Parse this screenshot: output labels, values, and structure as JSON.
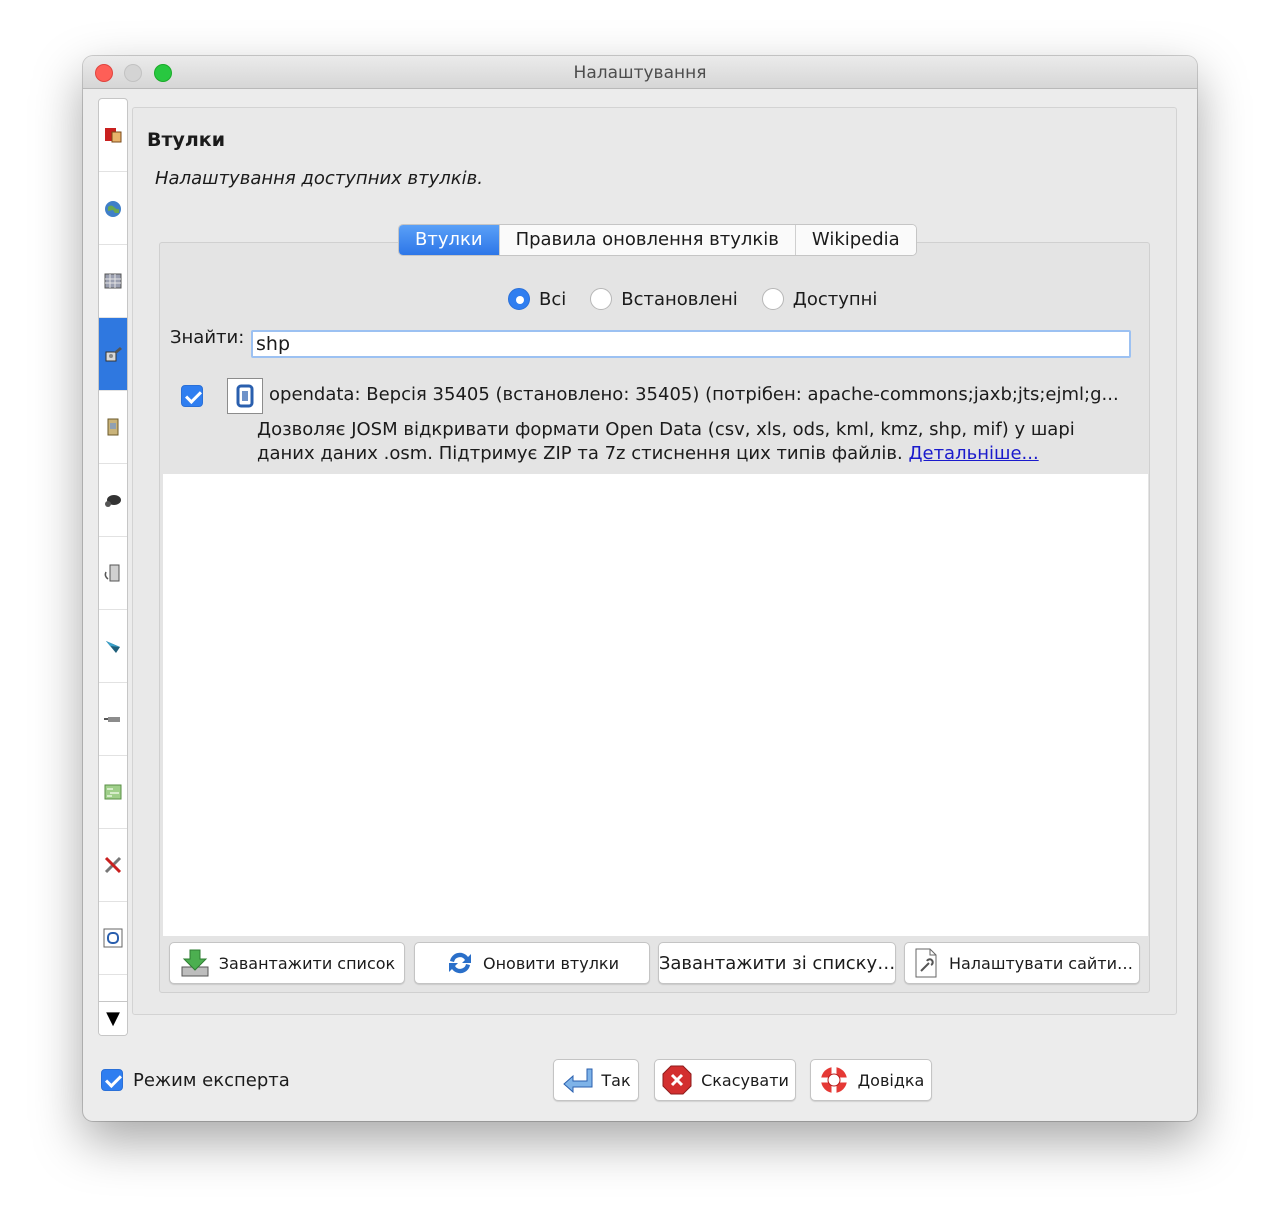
{
  "window": {
    "title": "Налаштування"
  },
  "sidebar": {
    "items": [
      {
        "icon": "display-settings-icon"
      },
      {
        "icon": "globe-icon"
      },
      {
        "icon": "map-grid-icon"
      },
      {
        "icon": "plugin-icon",
        "selected": true
      },
      {
        "icon": "presets-icon"
      },
      {
        "icon": "shortcuts-icon"
      },
      {
        "icon": "connection-icon"
      },
      {
        "icon": "remote-control-icon"
      },
      {
        "icon": "projection-icon"
      },
      {
        "icon": "map-paint-icon"
      },
      {
        "icon": "advanced-tools-icon"
      },
      {
        "icon": "opendata-icon"
      }
    ],
    "scroll_down": "▼"
  },
  "page": {
    "title": "Втулки",
    "description": "Налаштування доступних втулків."
  },
  "tabs": [
    {
      "label": "Втулки",
      "active": true
    },
    {
      "label": "Правила оновлення втулків",
      "active": false
    },
    {
      "label": "Wikipedia",
      "active": false
    }
  ],
  "filter": {
    "options": [
      {
        "label": "Всі",
        "selected": true
      },
      {
        "label": "Встановлені",
        "selected": false
      },
      {
        "label": "Доступні",
        "selected": false
      }
    ]
  },
  "search": {
    "label": "Знайти:",
    "value": "shp"
  },
  "plugin": {
    "checked": true,
    "name": "opendata: Версія 35405 (встановлено: 35405) (потрібен: apache-commons;jaxb;jts;ejml;g...",
    "description": "Дозволяє JOSM відкривати формати Open Data (csv, xls, ods, kml, kmz, shp, mif) у шарі даних даних .osm. Підтримує ZIP та 7z стиснення цих типів файлів.",
    "link": "Детальніше..."
  },
  "actions": {
    "download_list": "Завантажити список",
    "update_plugins": "Оновити втулки",
    "download_from_list": "Завантажити зі списку…",
    "configure_sites": "Налаштувати сайти…"
  },
  "footer": {
    "expert_mode": "Режим експерта",
    "expert_checked": true,
    "ok": "Так",
    "cancel": "Скасувати",
    "help": "Довідка"
  }
}
